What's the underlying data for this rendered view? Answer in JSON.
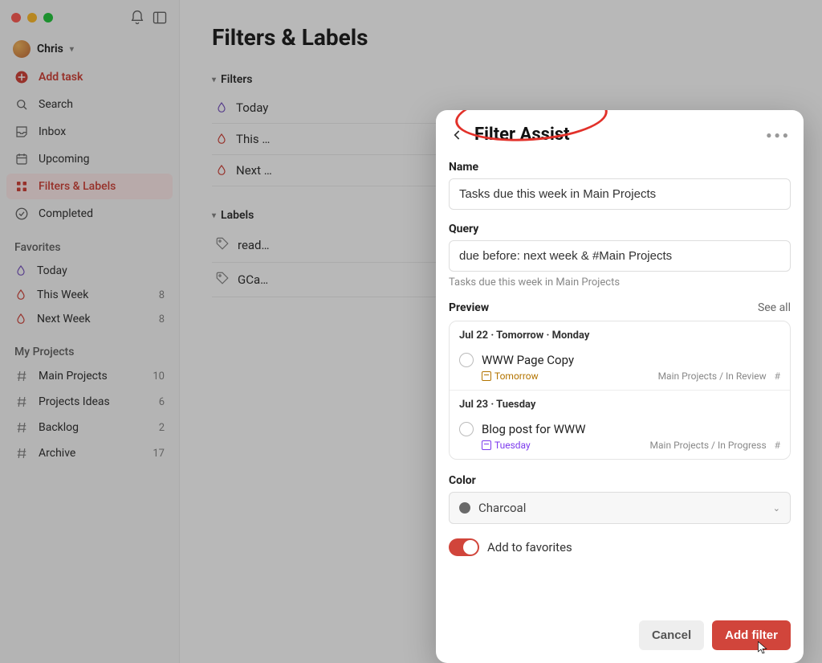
{
  "user": {
    "name": "Chris"
  },
  "sidebar": {
    "addTask": "Add task",
    "search": "Search",
    "inbox": "Inbox",
    "upcoming": "Upcoming",
    "filtersLabels": "Filters & Labels",
    "completed": "Completed",
    "favoritesHeader": "Favorites",
    "favorites": [
      {
        "label": "Today",
        "count": "",
        "color": "#7b57c2"
      },
      {
        "label": "This Week",
        "count": "8",
        "color": "#d1453b"
      },
      {
        "label": "Next Week",
        "count": "8",
        "color": "#d1453b"
      }
    ],
    "projectsHeader": "My Projects",
    "projects": [
      {
        "label": "Main Projects",
        "count": "10"
      },
      {
        "label": "Projects Ideas",
        "count": "6"
      },
      {
        "label": "Backlog",
        "count": "2"
      },
      {
        "label": "Archive",
        "count": "17"
      }
    ]
  },
  "main": {
    "title": "Filters & Labels",
    "filtersHeader": "Filters",
    "filters": [
      {
        "label": "Today",
        "color": "#7b57c2"
      },
      {
        "label": "This …",
        "color": "#d1453b"
      },
      {
        "label": "Next …",
        "color": "#d1453b"
      }
    ],
    "labelsHeader": "Labels",
    "labels": [
      {
        "label": "read…"
      },
      {
        "label": "GCa…"
      }
    ]
  },
  "modal": {
    "title": "Filter Assist",
    "nameLabel": "Name",
    "nameValue": "Tasks due this week in Main Projects",
    "queryLabel": "Query",
    "queryValue": "due before: next week & #Main Projects",
    "queryHint": "Tasks due this week in Main Projects",
    "previewLabel": "Preview",
    "seeAll": "See all",
    "groups": [
      {
        "date": "Jul 22 · Tomorrow · Monday",
        "task": {
          "title": "WWW Page Copy",
          "due": "Tomorrow",
          "dueStyle": "orange",
          "path": "Main Projects / In Review"
        }
      },
      {
        "date": "Jul 23 · Tuesday",
        "task": {
          "title": "Blog post for WWW",
          "due": "Tuesday",
          "dueStyle": "purple",
          "path": "Main Projects / In Progress"
        }
      }
    ],
    "colorLabel": "Color",
    "colorValue": "Charcoal",
    "favToggleLabel": "Add to favorites",
    "cancel": "Cancel",
    "submit": "Add filter"
  }
}
